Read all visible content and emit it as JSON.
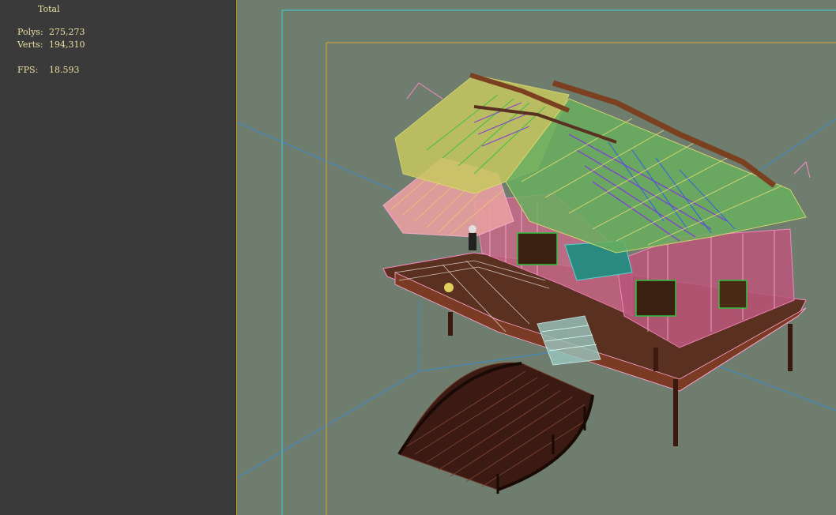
{
  "stats": {
    "header": "Total",
    "polys_label": "Polys:",
    "polys_value": "275,273",
    "verts_label": "Verts:",
    "verts_value": "194,310",
    "fps_label": "FPS:",
    "fps_value": "18.593"
  },
  "colors": {
    "panel_bg": "#3a3a3a",
    "viewport_bg": "#6e7d6e",
    "stat_text": "#e8e0a0",
    "safe_frame_outer": "#40d0d0",
    "safe_frame_inner": "#d8a830",
    "wire_pink": "#ff88c8",
    "wire_brown": "#5a2a1a",
    "wire_green": "#30c040",
    "wire_purple": "#8040d0",
    "wire_yellow": "#e0e070",
    "wire_cyan": "#60d0d0"
  },
  "viewport": {
    "scene_objects": [
      "pavilion-house",
      "arched-bridge"
    ]
  }
}
